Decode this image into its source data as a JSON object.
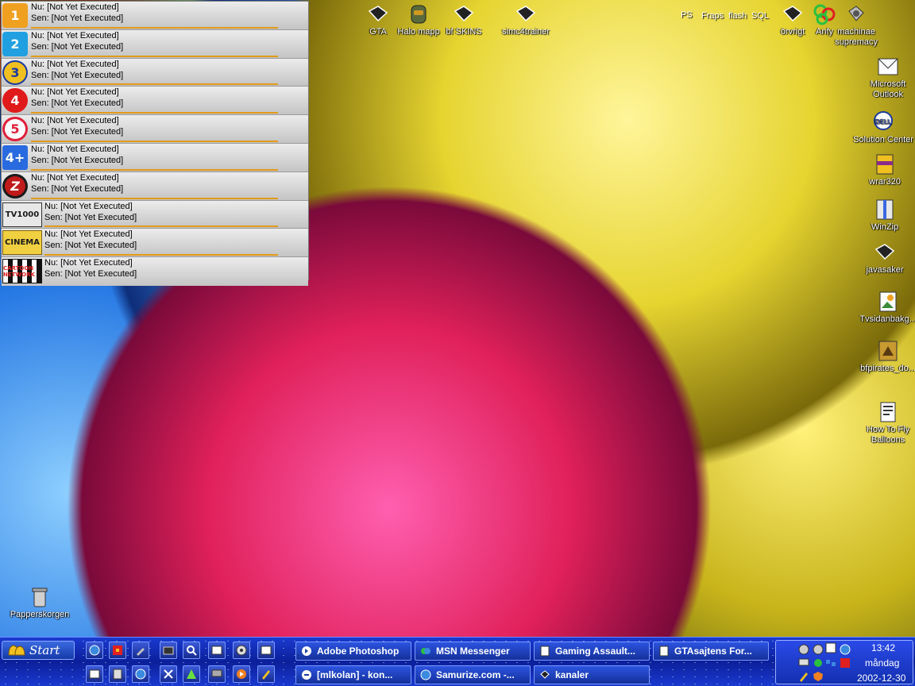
{
  "channels": [
    {
      "logo": "1",
      "logo_color": "#f0a020",
      "now": "Nu: [Not Yet Executed]",
      "later": "Sen: [Not Yet Executed]"
    },
    {
      "logo": "2",
      "logo_color": "#20a0e0",
      "now": "Nu: [Not Yet Executed]",
      "later": "Sen: [Not Yet Executed]"
    },
    {
      "logo": "3",
      "logo_color": "#1a3aa0",
      "now": "Nu: [Not Yet Executed]",
      "later": "Sen: [Not Yet Executed]"
    },
    {
      "logo": "4",
      "logo_color": "#e01a1a",
      "now": "Nu: [Not Yet Executed]",
      "later": "Sen: [Not Yet Executed]"
    },
    {
      "logo": "5",
      "logo_color": "#e0203a",
      "now": "Nu: [Not Yet Executed]",
      "later": "Sen: [Not Yet Executed]"
    },
    {
      "logo": "4+",
      "logo_color": "#2a6ae0",
      "now": "Nu: [Not Yet Executed]",
      "later": "Sen: [Not Yet Executed]"
    },
    {
      "logo": "Z",
      "logo_color": "#c01a1a",
      "now": "Nu: [Not Yet Executed]",
      "later": "Sen: [Not Yet Executed]"
    },
    {
      "logo": "TV1000",
      "logo_color": "#3a3a3a",
      "now": "Nu: [Not Yet Executed]",
      "later": "Sen: [Not Yet Executed]"
    },
    {
      "logo": "CINEMA",
      "logo_color": "#b08a10",
      "now": "Nu: [Not Yet Executed]",
      "later": "Sen: [Not Yet Executed]"
    },
    {
      "logo": "CARTOON NETWORK",
      "logo_color": "#1a1a1a",
      "now": "Nu: [Not Yet Executed]",
      "later": "Sen: [Not Yet Executed]"
    }
  ],
  "desktop": {
    "top_icons": [
      "GTA",
      "Halo mapp",
      "bf SKINS",
      "simc4trainer"
    ],
    "top_right_labels": [
      "PS",
      "Fraps",
      "flash",
      "SQL"
    ],
    "right_icons": [
      "örvrigt",
      "Anfy",
      "machinae supremacy",
      "Microsoft Outlook",
      "Solution Center",
      "wrar320",
      "WinZip",
      "javasaker",
      "Tvsidanbakg...",
      "bfpirates_do...",
      "How To Fly Balloons"
    ],
    "recycle_bin": "Papperskorgen"
  },
  "taskbar": {
    "start_label": "Start",
    "tasks_row1": [
      "Adobe Photoshop",
      "MSN Messenger",
      "Gaming Assault...",
      "GTAsajtens For..."
    ],
    "tasks_row2": [
      "[mlkolan] - kon...",
      "Samurize.com -...",
      "kanaler"
    ],
    "clock_time": "13:42",
    "clock_day": "måndag",
    "clock_date": "2002-12-30"
  }
}
